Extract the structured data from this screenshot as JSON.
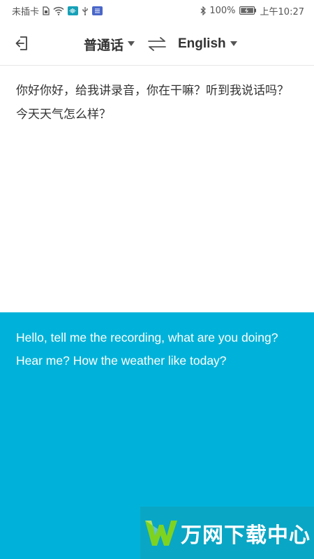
{
  "status_bar": {
    "carrier": "未插卡",
    "battery": "100%",
    "time": "上午10:27"
  },
  "header": {
    "source_language": "普通话",
    "target_language": "English"
  },
  "source": {
    "text": "你好你好，给我讲录音，你在干嘛？听到我说话吗？今天天气怎么样？"
  },
  "translation": {
    "text": "Hello, tell me the recording, what are you doing? Hear me? How the weather like today?"
  },
  "watermark": {
    "text": "万网下载中心"
  },
  "colors": {
    "accent": "#00b2d9",
    "text_dark": "#333333"
  }
}
